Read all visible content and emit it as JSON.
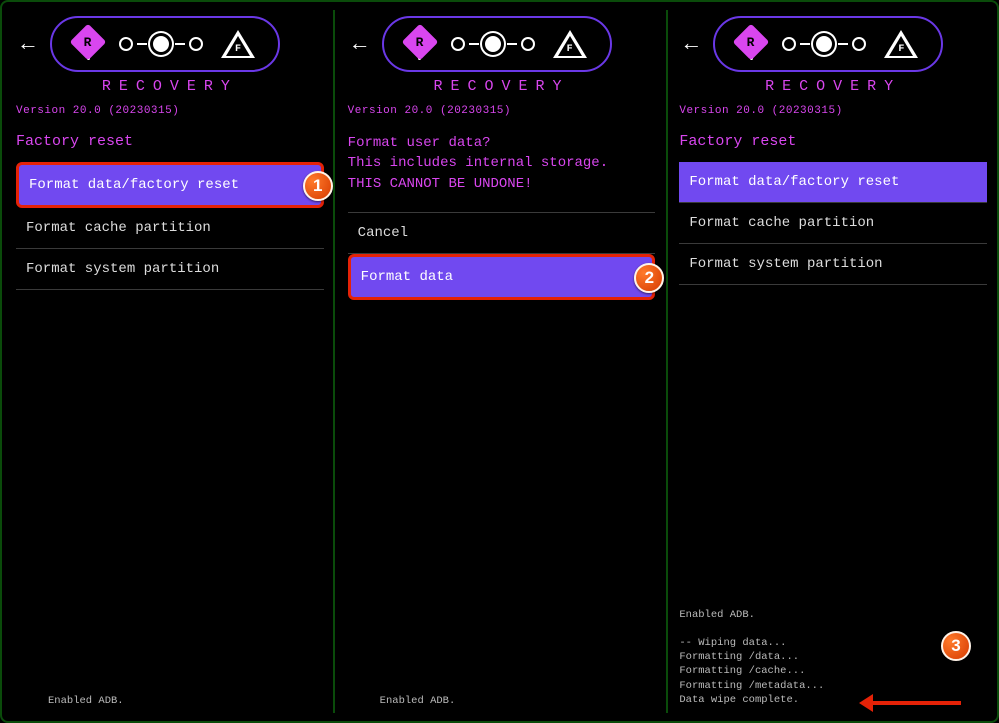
{
  "header": {
    "title": "RECOVERY",
    "version": "Version 20.0 (20230315)",
    "badge_r": "R",
    "badge_f": "F"
  },
  "panel1": {
    "section": "Factory reset",
    "items": [
      "Format data/factory reset",
      "Format cache partition",
      "Format system partition"
    ],
    "footer": "Enabled ADB.",
    "callout_num": "1"
  },
  "panel2": {
    "warn_l1": "Format user data?",
    "warn_l2": "This includes internal storage.",
    "warn_l3": "THIS CANNOT BE UNDONE!",
    "items": [
      "Cancel",
      "Format data"
    ],
    "footer": "Enabled ADB.",
    "callout_num": "2"
  },
  "panel3": {
    "section": "Factory reset",
    "items": [
      "Format data/factory reset",
      "Format cache partition",
      "Format system partition"
    ],
    "log": "Enabled ADB.\n\n-- Wiping data...\nFormatting /data...\nFormatting /cache...\nFormatting /metadata...\nData wipe complete.",
    "callout_num": "3"
  }
}
